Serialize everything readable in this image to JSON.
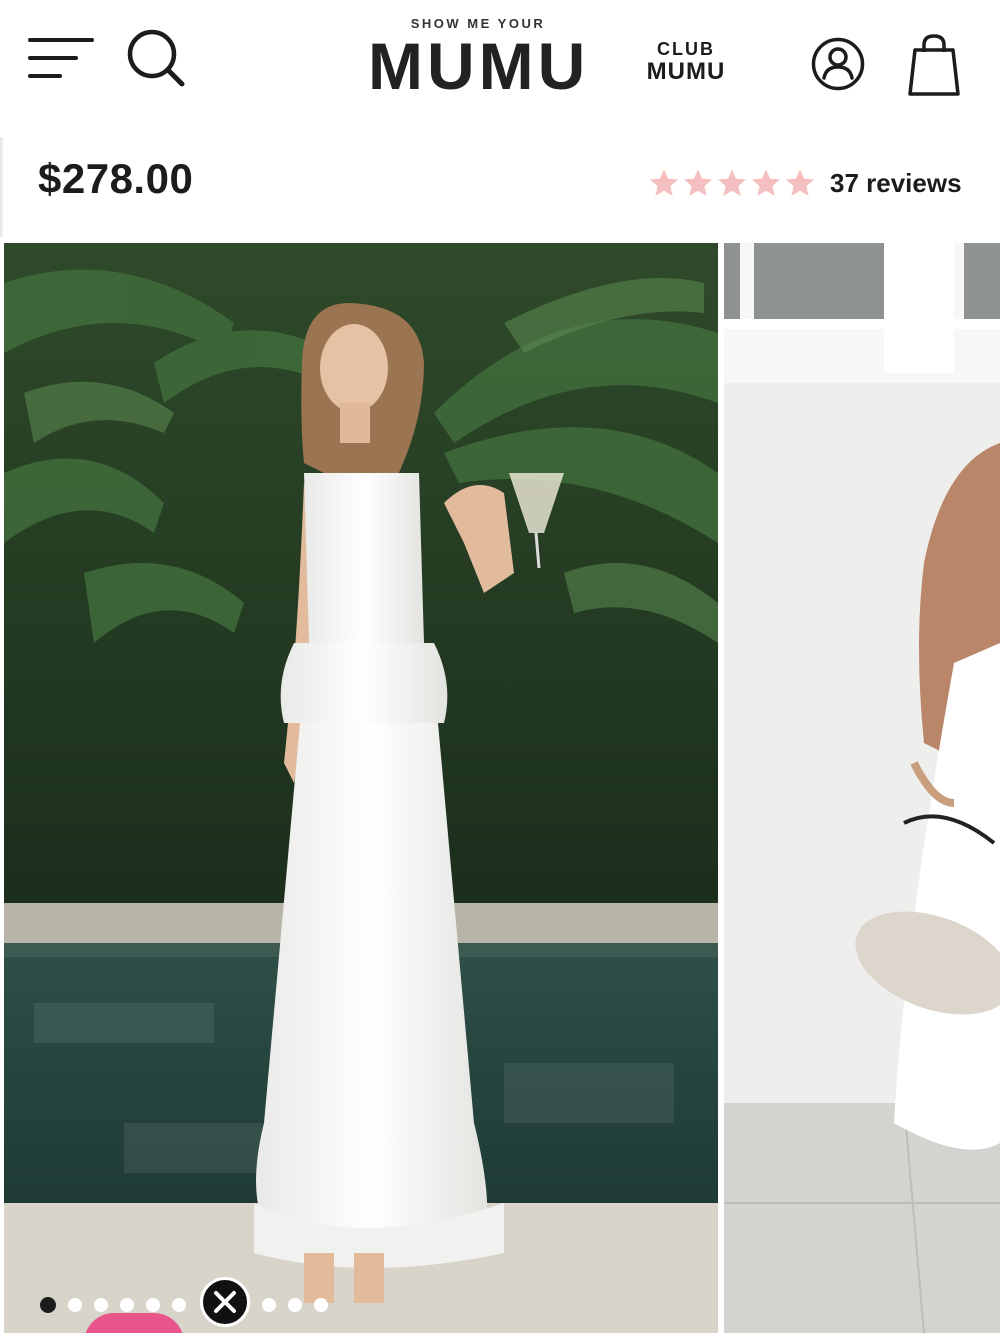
{
  "brand": {
    "logo_small": "SHOW ME YOUR",
    "logo_big": "MUMU",
    "club_top": "CLUB",
    "club_bottom": "MUMU"
  },
  "icons": {
    "menu": "hamburger-menu-icon",
    "search": "search-icon",
    "account": "user-account-icon",
    "bag": "shopping-bag-icon",
    "close": "close-icon",
    "star": "star-icon"
  },
  "product": {
    "price": "$278.00",
    "rating": 5,
    "reviews_label": "37 reviews"
  },
  "gallery": {
    "slide_count": 10,
    "active_index": 0
  },
  "colors": {
    "text": "#1c1c1c",
    "star": "#f6bfbf",
    "accent_pink": "#e8568c",
    "background": "#ffffff"
  }
}
